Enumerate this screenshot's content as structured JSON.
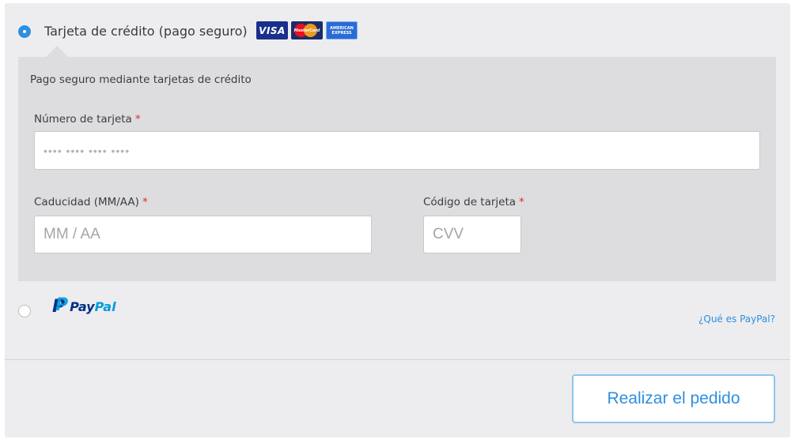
{
  "payment": {
    "credit_card": {
      "label": "Tarjeta de crédito (pago seguro)",
      "selected": true,
      "logos": [
        {
          "name": "visa-logo",
          "text": "VISA"
        },
        {
          "name": "mastercard-logo",
          "text": "MasterCard"
        },
        {
          "name": "amex-logo",
          "text": "AMERICAN EXPRESS"
        }
      ],
      "description": "Pago seguro mediante tarjetas de crédito",
      "fields": {
        "card_number": {
          "label": "Número de tarjeta",
          "required_mark": "*",
          "placeholder": "•••• •••• •••• ••••"
        },
        "expiry": {
          "label": "Caducidad (MM/AA)",
          "required_mark": "*",
          "placeholder": "MM / AA"
        },
        "cvv": {
          "label": "Código de tarjeta",
          "required_mark": "*",
          "placeholder": "CVV"
        }
      }
    },
    "paypal": {
      "logo_text_pay": "Pay",
      "logo_text_pal": "Pal",
      "selected": false,
      "info_link": "¿Qué es PayPal?"
    }
  },
  "actions": {
    "place_order_label": "Realizar el pedido"
  },
  "colors": {
    "accent": "#2e8fe0",
    "required": "#e02b2b",
    "paypal_dark": "#003087",
    "paypal_light": "#009cde"
  }
}
